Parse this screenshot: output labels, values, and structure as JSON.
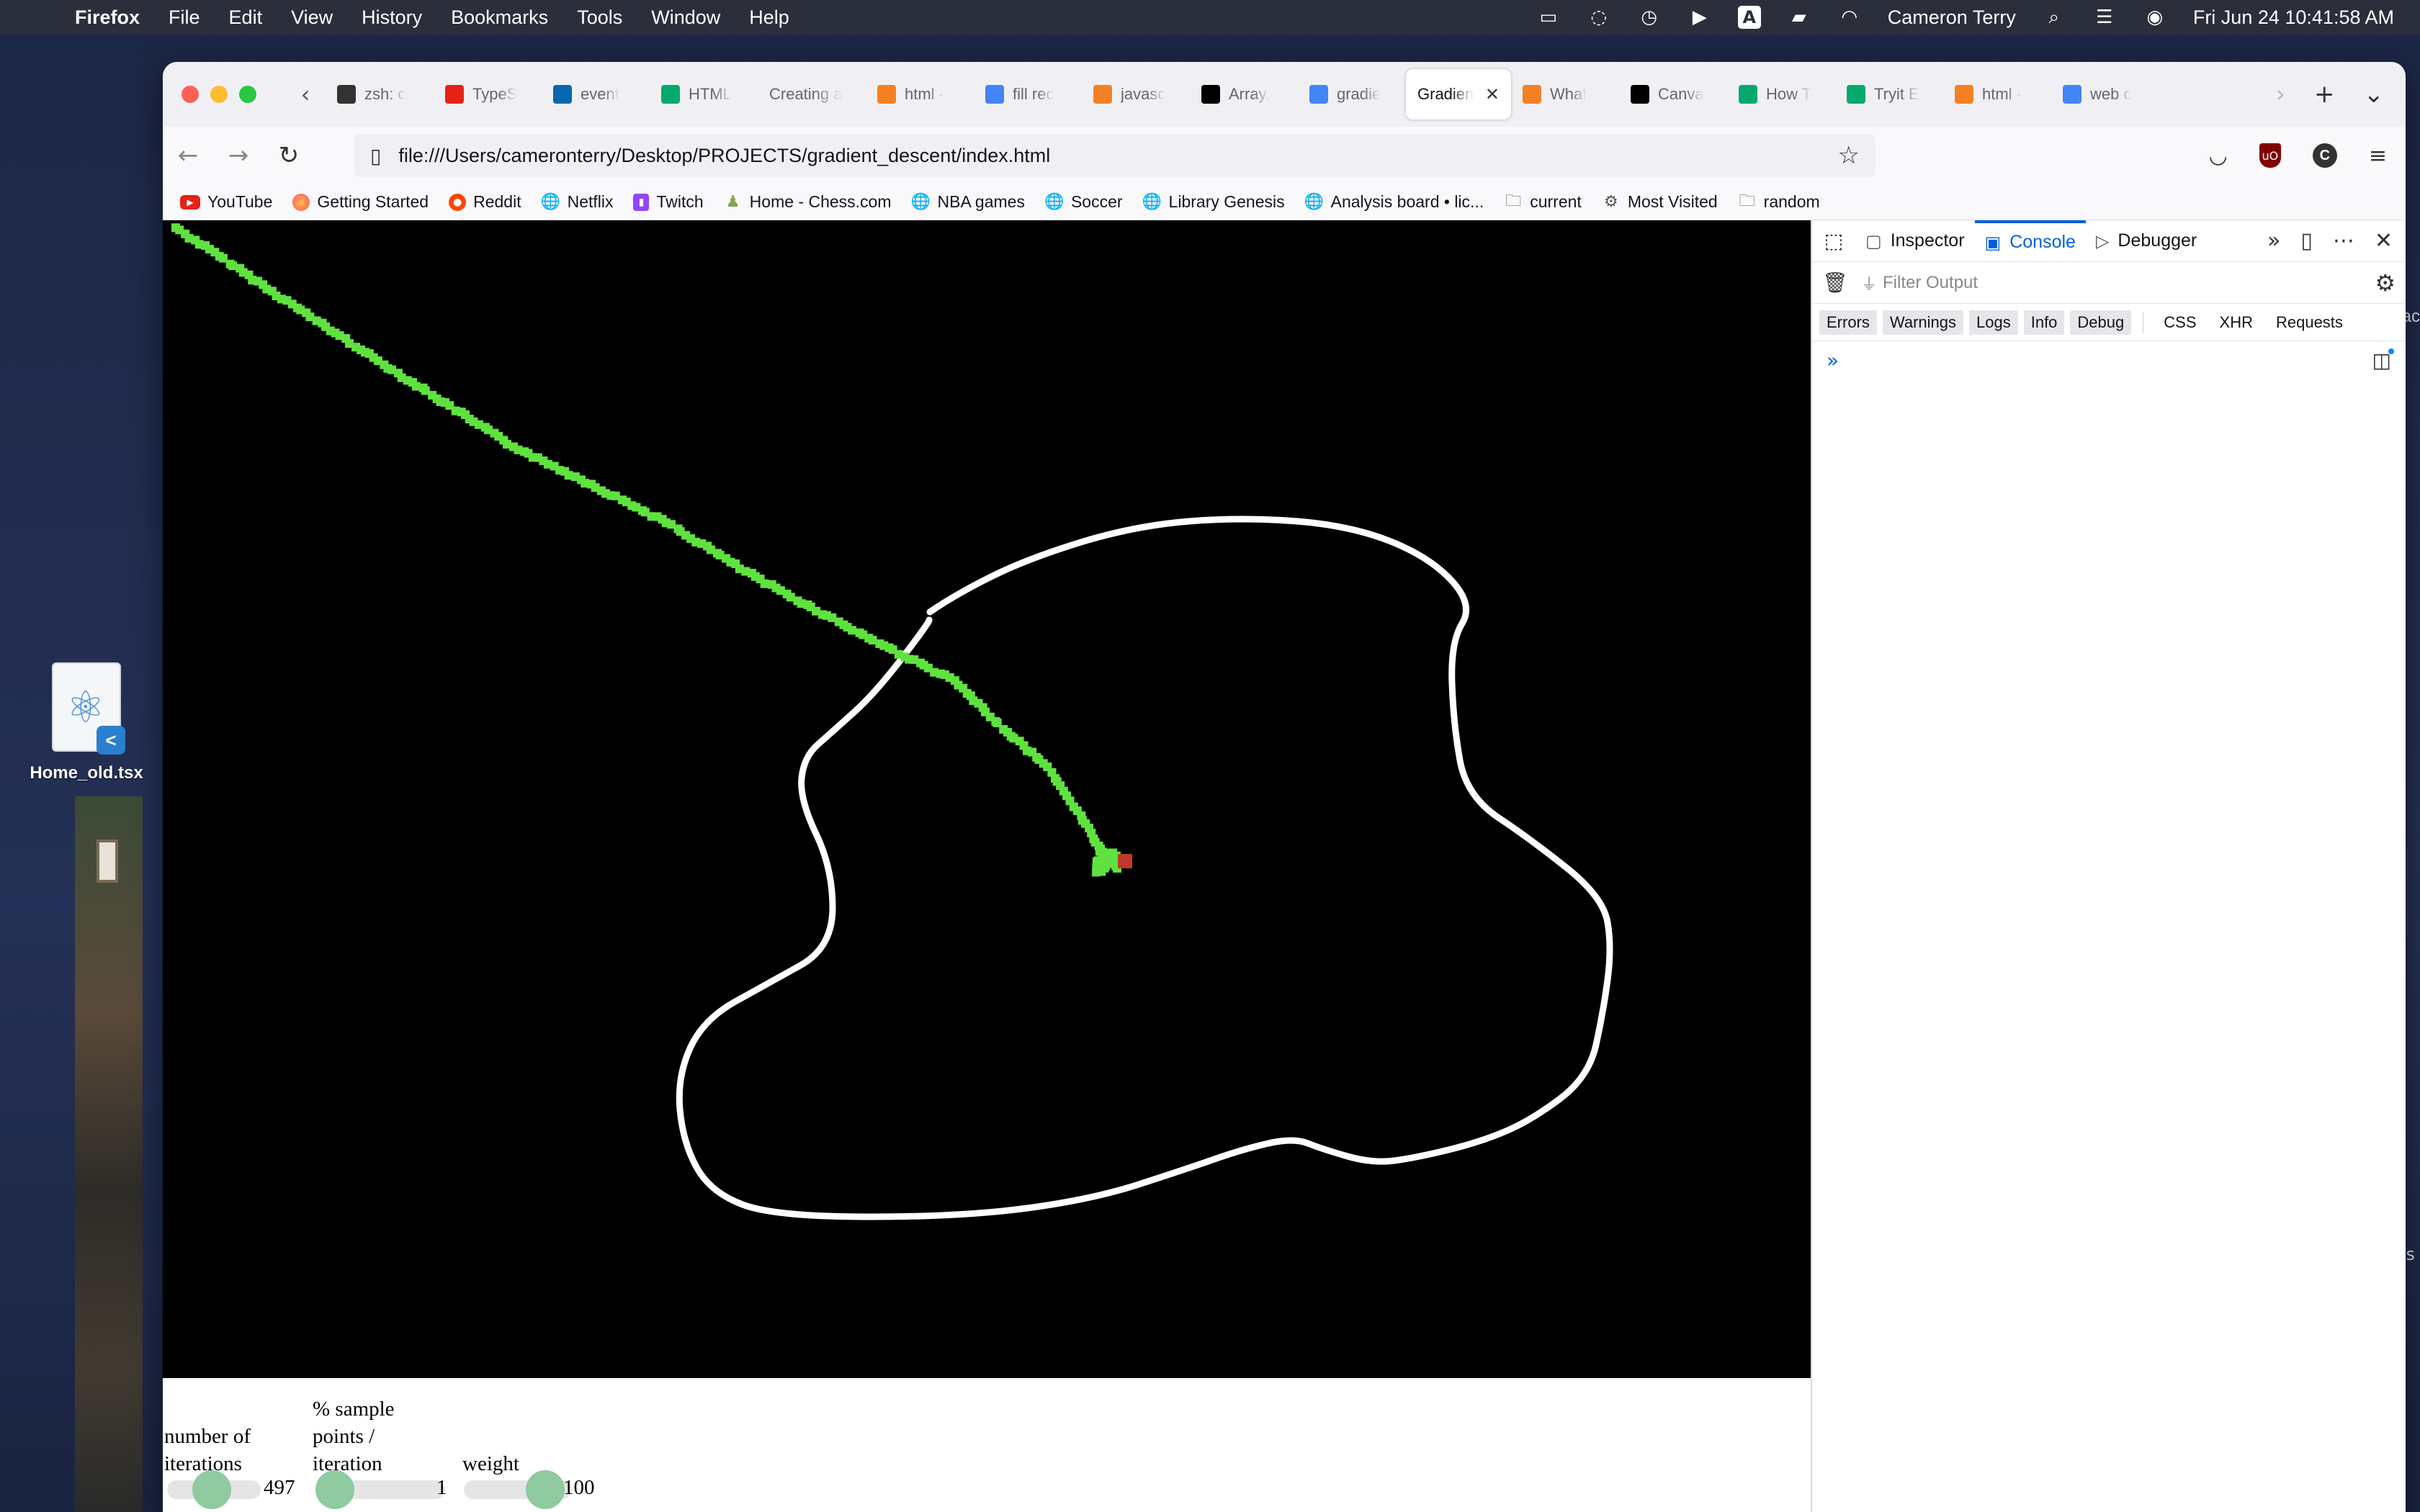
{
  "menubar": {
    "app_name": "Firefox",
    "items": [
      "File",
      "Edit",
      "View",
      "History",
      "Bookmarks",
      "Tools",
      "Window",
      "Help"
    ],
    "status_icons": [
      "cast-icon",
      "sync-icon",
      "time-machine-icon",
      "play-icon",
      "input-source-icon",
      "battery-icon",
      "wifi-icon"
    ],
    "input_source": "A",
    "user": "Cameron Terry",
    "clock": "Fri Jun 24  10:41:58 AM"
  },
  "tabs": [
    {
      "label": "zsh: c",
      "icon": "terminal-icon",
      "color": "#333333"
    },
    {
      "label": "TypeS",
      "icon": "youtube-icon",
      "color": "#e62117"
    },
    {
      "label": "event",
      "icon": "jquery-icon",
      "color": "#0769ad"
    },
    {
      "label": "HTML",
      "icon": "w3schools-icon",
      "color": "#04aa6d"
    },
    {
      "label": "Creating a",
      "icon": "",
      "color": ""
    },
    {
      "label": "html -",
      "icon": "stackoverflow-icon",
      "color": "#f48024"
    },
    {
      "label": "fill rec",
      "icon": "google-icon",
      "color": "#4285f4"
    },
    {
      "label": "javasc",
      "icon": "stackoverflow-icon",
      "color": "#f48024"
    },
    {
      "label": "Array.",
      "icon": "mdn-icon",
      "color": "#000000"
    },
    {
      "label": "gradie",
      "icon": "google-icon",
      "color": "#4285f4"
    },
    {
      "label": "Gradien",
      "icon": "",
      "color": "",
      "active": true
    },
    {
      "label": "What",
      "icon": "stackoverflow-icon",
      "color": "#f48024"
    },
    {
      "label": "Canva",
      "icon": "mdn-icon",
      "color": "#000000"
    },
    {
      "label": "How T",
      "icon": "w3schools-icon",
      "color": "#04aa6d"
    },
    {
      "label": "Tryit E",
      "icon": "w3schools-icon",
      "color": "#04aa6d"
    },
    {
      "label": "html -",
      "icon": "stackoverflow-icon",
      "color": "#f48024"
    },
    {
      "label": "web c",
      "icon": "google-icon",
      "color": "#4285f4"
    }
  ],
  "url": "file:///Users/cameronterry/Desktop/PROJECTS/gradient_descent/index.html",
  "bookmarks": [
    {
      "label": "YouTube",
      "icon": "youtube-icon"
    },
    {
      "label": "Getting Started",
      "icon": "firefox-icon"
    },
    {
      "label": "Reddit",
      "icon": "reddit-icon"
    },
    {
      "label": "Netflix",
      "icon": "globe-icon"
    },
    {
      "label": "Twitch",
      "icon": "twitch-icon"
    },
    {
      "label": "Home - Chess.com",
      "icon": "chess-icon"
    },
    {
      "label": "NBA games",
      "icon": "globe-icon"
    },
    {
      "label": "Soccer",
      "icon": "globe-icon"
    },
    {
      "label": "Library Genesis",
      "icon": "globe-icon"
    },
    {
      "label": "Analysis board • lic...",
      "icon": "globe-icon"
    },
    {
      "label": "current",
      "icon": "folder-icon"
    },
    {
      "label": "Most Visited",
      "icon": "gear-icon"
    },
    {
      "label": "random",
      "icon": "folder-icon"
    }
  ],
  "controls": {
    "iterations": {
      "label": "number of iterations",
      "value": "497",
      "position": 0.48
    },
    "sample_points": {
      "label": "% sample points / iteration",
      "value": "1",
      "position": 0.15
    },
    "weight": {
      "label": "weight",
      "value": "100",
      "position": 0.75
    }
  },
  "colors": {
    "path": "#5fe23f",
    "curve": "#ffffff",
    "target": "#c0392b",
    "canvas_bg": "#000000",
    "slider_thumb": "#8fcaa1"
  },
  "devtools": {
    "tabs": [
      {
        "label": "Inspector",
        "icon": "inspector-icon"
      },
      {
        "label": "Console",
        "icon": "console-icon",
        "active": true
      },
      {
        "label": "Debugger",
        "icon": "debugger-icon"
      }
    ],
    "filter_placeholder": "Filter Output",
    "levels": [
      "Errors",
      "Warnings",
      "Logs",
      "Info",
      "Debug"
    ],
    "categories": [
      "CSS",
      "XHR",
      "Requests"
    ]
  },
  "desktop": {
    "file_name": "Home_old.tsx",
    "edge_text_1": "lac",
    "edge_text_2": "is"
  }
}
